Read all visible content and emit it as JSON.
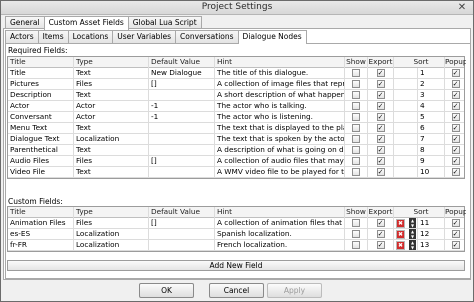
{
  "window": {
    "title": "Project Settings",
    "close_icon": "close-icon"
  },
  "tabs_top": [
    {
      "label": "General",
      "active": false
    },
    {
      "label": "Custom Asset Fields",
      "active": true
    },
    {
      "label": "Global Lua Script",
      "active": false
    }
  ],
  "tabs_sub": [
    {
      "label": "Actors",
      "active": false
    },
    {
      "label": "Items",
      "active": false
    },
    {
      "label": "Locations",
      "active": false
    },
    {
      "label": "User Variables",
      "active": false
    },
    {
      "label": "Conversations",
      "active": false
    },
    {
      "label": "Dialogue Nodes",
      "active": true
    }
  ],
  "columns": {
    "title": "Title",
    "type": "Type",
    "default": "Default Value",
    "hint": "Hint",
    "show": "Show",
    "export": "Export",
    "sort": "Sort",
    "popup": "Popup"
  },
  "required": {
    "label": "Required Fields:",
    "rows": [
      {
        "title": "Title",
        "type": "Text",
        "default": "New Dialogue",
        "hint": "The title of this dialogue.",
        "show": false,
        "export": true,
        "sort": "1",
        "popup": true
      },
      {
        "title": "Pictures",
        "type": "Files",
        "default": "[]",
        "hint": "A collection of image files that represent",
        "show": false,
        "export": true,
        "sort": "2",
        "popup": true
      },
      {
        "title": "Description",
        "type": "Text",
        "default": "",
        "hint": "A short description of what happens in th",
        "show": false,
        "export": true,
        "sort": "3",
        "popup": true
      },
      {
        "title": "Actor",
        "type": "Actor",
        "default": "-1",
        "hint": "The actor who is talking.",
        "show": false,
        "export": true,
        "sort": "4",
        "popup": true
      },
      {
        "title": "Conversant",
        "type": "Actor",
        "default": "-1",
        "hint": "The actor who is listening.",
        "show": false,
        "export": true,
        "sort": "5",
        "popup": true
      },
      {
        "title": "Menu Text",
        "type": "Text",
        "default": "",
        "hint": "The text that is displayed to the player in a",
        "show": false,
        "export": true,
        "sort": "6",
        "popup": true
      },
      {
        "title": "Dialogue Text",
        "type": "Localization",
        "default": "",
        "hint": "The text that is spoken by the actor.",
        "show": false,
        "export": true,
        "sort": "7",
        "popup": true
      },
      {
        "title": "Parenthetical",
        "type": "Text",
        "default": "",
        "hint": "A description of what is going on during",
        "show": false,
        "export": true,
        "sort": "8",
        "popup": true
      },
      {
        "title": "Audio Files",
        "type": "Files",
        "default": "[]",
        "hint": "A collection of audio files that may be pla",
        "show": false,
        "export": true,
        "sort": "9",
        "popup": true
      },
      {
        "title": "Video File",
        "type": "Text",
        "default": "",
        "hint": "A WMV video file to be played for this dia",
        "show": false,
        "export": true,
        "sort": "10",
        "popup": true
      }
    ]
  },
  "custom": {
    "label": "Custom Fields:",
    "rows": [
      {
        "title": "Animation Files",
        "type": "Files",
        "default": "[]",
        "hint": "A collection of animation files that should",
        "show": false,
        "export": true,
        "sort": "11",
        "popup": true
      },
      {
        "title": "es-ES",
        "type": "Localization",
        "default": "",
        "hint": "Spanish localization.",
        "show": false,
        "export": true,
        "sort": "12",
        "popup": true
      },
      {
        "title": "fr-FR",
        "type": "Localization",
        "default": "",
        "hint": "French localization.",
        "show": false,
        "export": true,
        "sort": "13",
        "popup": true
      }
    ],
    "add_button": "Add New Field"
  },
  "footer": {
    "ok": "OK",
    "cancel": "Cancel",
    "apply": "Apply"
  }
}
